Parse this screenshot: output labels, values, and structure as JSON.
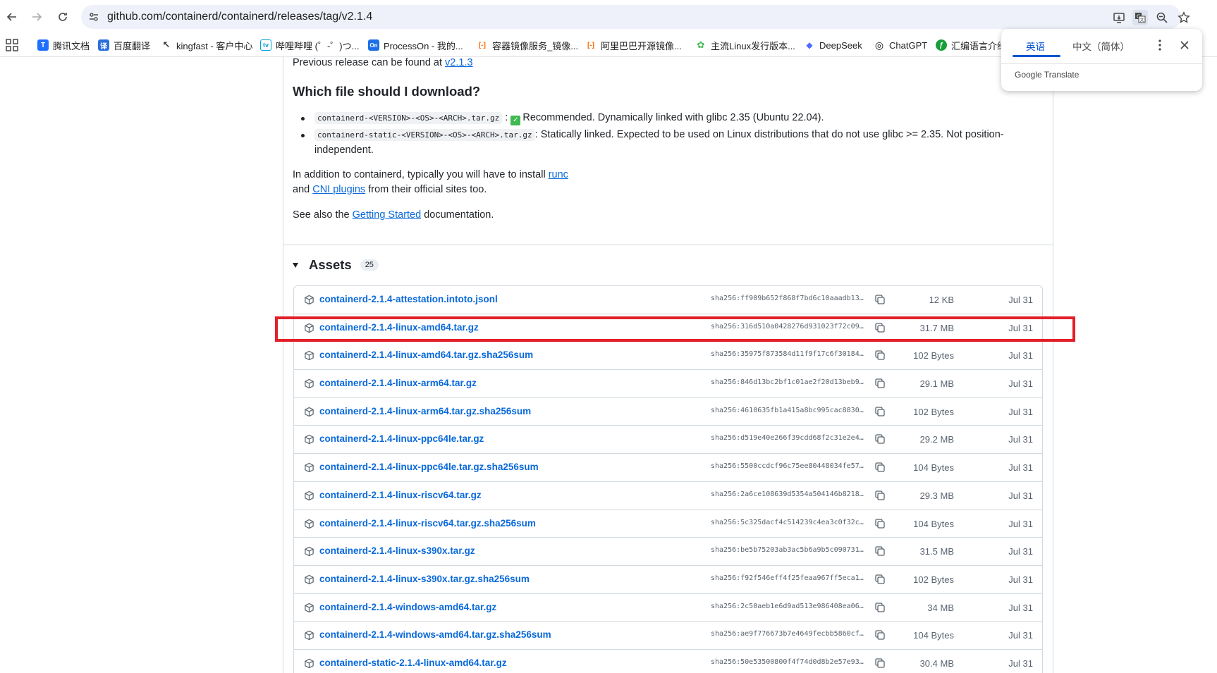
{
  "browser": {
    "url": "github.com/containerd/containerd/releases/tag/v2.1.4",
    "bookmarks": [
      {
        "label": "腾讯文档",
        "color": "#1e6fff",
        "glyph": "T"
      },
      {
        "label": "百度翻译",
        "color": "#2b6fde",
        "glyph": "译"
      },
      {
        "label": "kingfast - 客户中心",
        "color": "#333333",
        "glyph": "↖"
      },
      {
        "label": "哔哩哔哩 (゜-゜)つ...",
        "color": "#00a1d6",
        "glyph": "b"
      },
      {
        "label": "ProcessOn - 我的...",
        "color": "#1d6fe8",
        "glyph": "On"
      },
      {
        "label": "容器镜像服务_镜像...",
        "color": "#ff6a00",
        "glyph": "[-]"
      },
      {
        "label": "阿里巴巴开源镜像...",
        "color": "#ff6a00",
        "glyph": "[-]"
      },
      {
        "label": "主流Linux发行版本...",
        "color": "#3fb950",
        "glyph": "✿"
      },
      {
        "label": "DeepSeek",
        "color": "#4d6bfe",
        "glyph": "🐋"
      },
      {
        "label": "ChatGPT",
        "color": "#111111",
        "glyph": "◎"
      },
      {
        "label": "汇编语言介绍",
        "color": "#1a9e3a",
        "glyph": "ƒ"
      }
    ]
  },
  "translate_popup": {
    "source_lang": "英语",
    "target_lang": "中文（简体）",
    "brand": "Google Translate"
  },
  "release": {
    "previous_text": "Previous release can be found at",
    "previous_link": "v2.1.3",
    "which_heading": "Which file should I download?",
    "bullet1_code": "containerd-<VERSION>-<OS>-<ARCH>.tar.gz",
    "bullet1_text": "Recommended. Dynamically linked with glibc 2.35 (Ubuntu 22.04).",
    "bullet2_code": "containerd-static-<VERSION>-<OS>-<ARCH>.tar.gz",
    "bullet2_text_a": ": Statically linked. Expected to be used on Linux distributions that do not use glibc >= 2.35. Not position-",
    "bullet2_text_b": "independent.",
    "runc_text": "In addition to containerd, typically you will have to install",
    "runc_link": "runc",
    "cni_pre": "and",
    "cni_link": "CNI plugins",
    "cni_post": "from their official sites too.",
    "see_pre": "See also the",
    "see_link": "Getting Started",
    "see_post": "documentation."
  },
  "assets": {
    "title": "Assets",
    "count": "25",
    "rows": [
      {
        "name": "containerd-2.1.4-attestation.intoto.jsonl",
        "sha": "sha256:ff909b652f868f7bd6c10aaadb13a...",
        "size": "12 KB",
        "date": "Jul 31"
      },
      {
        "name": "containerd-2.1.4-linux-amd64.tar.gz",
        "sha": "sha256:316d510a0428276d931023f72c09f...",
        "size": "31.7 MB",
        "date": "Jul 31"
      },
      {
        "name": "containerd-2.1.4-linux-amd64.tar.gz.sha256sum",
        "sha": "sha256:35975f873584d11f9f17c6f30184a...",
        "size": "102 Bytes",
        "date": "Jul 31"
      },
      {
        "name": "containerd-2.1.4-linux-arm64.tar.gz",
        "sha": "sha256:846d13bc2bf1c01ae2f20d13beb9b...",
        "size": "29.1 MB",
        "date": "Jul 31"
      },
      {
        "name": "containerd-2.1.4-linux-arm64.tar.gz.sha256sum",
        "sha": "sha256:4610635fb1a415a8bc995cac88305...",
        "size": "102 Bytes",
        "date": "Jul 31"
      },
      {
        "name": "containerd-2.1.4-linux-ppc64le.tar.gz",
        "sha": "sha256:d519e40e266f39cdd68f2c31e2e4e...",
        "size": "29.2 MB",
        "date": "Jul 31"
      },
      {
        "name": "containerd-2.1.4-linux-ppc64le.tar.gz.sha256sum",
        "sha": "sha256:5500ccdcf96c75ee80448034fe573...",
        "size": "104 Bytes",
        "date": "Jul 31"
      },
      {
        "name": "containerd-2.1.4-linux-riscv64.tar.gz",
        "sha": "sha256:2a6ce108639d5354a504146b82181...",
        "size": "29.3 MB",
        "date": "Jul 31"
      },
      {
        "name": "containerd-2.1.4-linux-riscv64.tar.gz.sha256sum",
        "sha": "sha256:5c325dacf4c514239c4ea3c0f32c8...",
        "size": "104 Bytes",
        "date": "Jul 31"
      },
      {
        "name": "containerd-2.1.4-linux-s390x.tar.gz",
        "sha": "sha256:be5b75203ab3ac5b6a9b5c0907315...",
        "size": "31.5 MB",
        "date": "Jul 31"
      },
      {
        "name": "containerd-2.1.4-linux-s390x.tar.gz.sha256sum",
        "sha": "sha256:f92f546eff4f25feaa967ff5eca1c...",
        "size": "102 Bytes",
        "date": "Jul 31"
      },
      {
        "name": "containerd-2.1.4-windows-amd64.tar.gz",
        "sha": "sha256:2c50aeb1e6d9ad513e986408ea066...",
        "size": "34 MB",
        "date": "Jul 31"
      },
      {
        "name": "containerd-2.1.4-windows-amd64.tar.gz.sha256sum",
        "sha": "sha256:ae9f776673b7e4649fecbb5860cfa...",
        "size": "104 Bytes",
        "date": "Jul 31"
      },
      {
        "name": "containerd-static-2.1.4-linux-amd64.tar.gz",
        "sha": "sha256:50e53500800f4f74d0d8b2e57e939...",
        "size": "30.4 MB",
        "date": "Jul 31"
      }
    ]
  },
  "colors": {
    "link": "#0969da",
    "highlight": "#e3202a",
    "muted": "#59636e"
  }
}
